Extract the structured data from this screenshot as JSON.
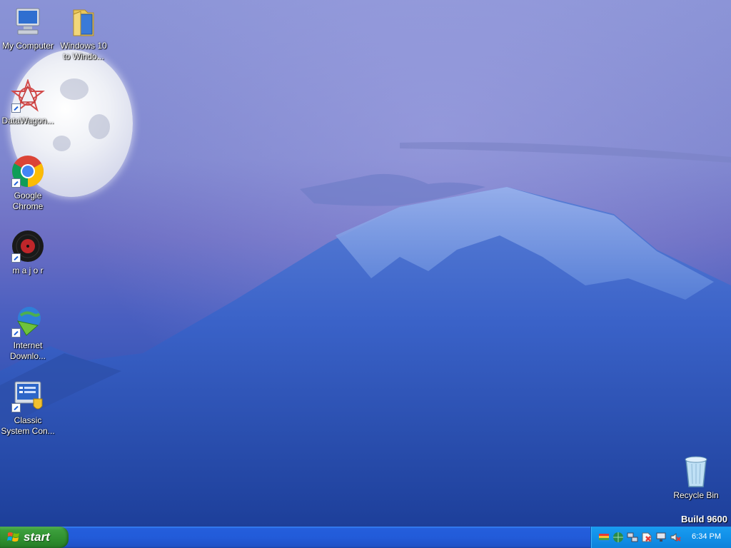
{
  "desktop": {
    "icons": [
      {
        "label": "My Computer",
        "icon": "my-computer-icon"
      },
      {
        "label": "Windows 10\nto Windo...",
        "label_line1": "Windows 10",
        "label_line2": "to Windo...",
        "icon": "folder-icon"
      },
      {
        "label": "DataWagon...",
        "icon": "datawagon-icon"
      },
      {
        "label_line1": "Google",
        "label_line2": "Chrome",
        "icon": "chrome-icon"
      },
      {
        "label": "m a j o r",
        "icon": "vinyl-record-icon"
      },
      {
        "label_line1": "Internet",
        "label_line2": "Downlo...",
        "icon": "internet-download-manager-icon"
      },
      {
        "label_line1": "Classic",
        "label_line2": "System Con...",
        "icon": "control-panel-icon"
      },
      {
        "label": "Recycle Bin",
        "icon": "recycle-bin-icon"
      }
    ],
    "build_label": "Build 9600"
  },
  "taskbar": {
    "start_label": "start",
    "tray_icons": [
      "color-bars-icon",
      "network-globe-icon",
      "network-computers-icon",
      "security-alert-icon",
      "network-status-icon",
      "volume-muted-icon"
    ],
    "clock": "6:34 PM"
  },
  "colors": {
    "taskbar_blue": "#245edc",
    "start_green": "#3c9f3c",
    "tray_blue": "#1190e8"
  }
}
